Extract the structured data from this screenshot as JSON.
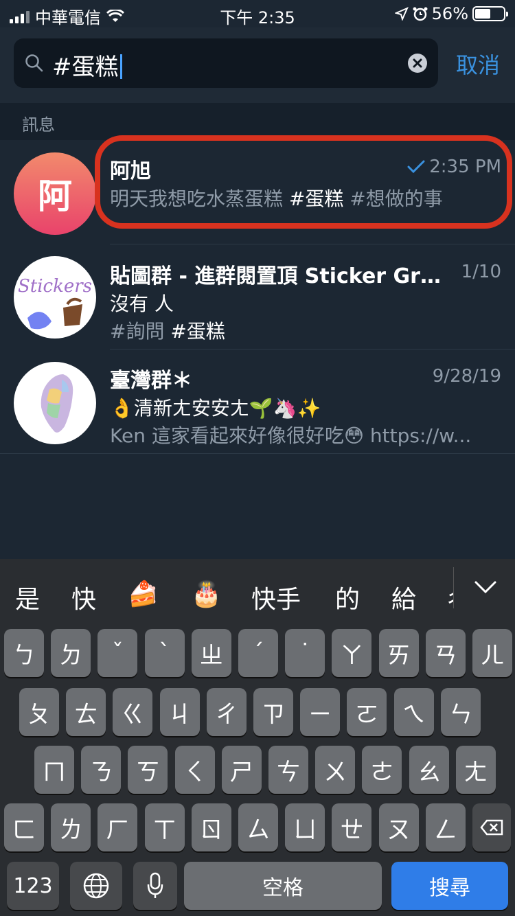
{
  "status_bar": {
    "carrier": "中華電信",
    "time": "下午 2:35",
    "battery": "56%",
    "battery_level": 0.56
  },
  "search": {
    "query": "#蛋糕",
    "cancel_label": "取消"
  },
  "section_header": "訊息",
  "results": [
    {
      "avatar_letter": "阿",
      "title": "阿旭",
      "time": "2:35 PM",
      "read": true,
      "preview_text": "明天我想吃水蒸蛋糕 ",
      "preview_tag1": "#蛋糕",
      "preview_tag2": " #想做的事"
    },
    {
      "avatar_text": "Stickers",
      "title": "貼圖群 - 進群閱置頂 Sticker Gro...",
      "time": "1/10",
      "line1": "沒有 人",
      "line2_tag1": "#詢問",
      "line2_tag2": " #蛋糕"
    },
    {
      "title": "臺灣群＊",
      "time": "9/28/19",
      "line1": "👌清新ㄤ安安ㄤ🌱🦄✨",
      "line2": "Ken 這家看起來好像很好吃😳 https://w..."
    }
  ],
  "suggestions": [
    "是",
    "快",
    "🍰",
    "🎂",
    "快手",
    "的",
    "給",
    "ㄔ"
  ],
  "keyboard": {
    "row1": [
      "ㄅ",
      "ㄉ",
      "ˇ",
      "ˋ",
      "ㄓ",
      "ˊ",
      "˙",
      "ㄚ",
      "ㄞ",
      "ㄢ",
      "ㄦ"
    ],
    "row2": [
      "ㄆ",
      "ㄊ",
      "ㄍ",
      "ㄐ",
      "ㄔ",
      "ㄗ",
      "ㄧ",
      "ㄛ",
      "ㄟ",
      "ㄣ"
    ],
    "row3": [
      "ㄇ",
      "ㄋ",
      "ㄎ",
      "ㄑ",
      "ㄕ",
      "ㄘ",
      "ㄨ",
      "ㄜ",
      "ㄠ",
      "ㄤ"
    ],
    "row4": [
      "ㄈ",
      "ㄌ",
      "ㄏ",
      "ㄒ",
      "ㄖ",
      "ㄙ",
      "ㄩ",
      "ㄝ",
      "ㄡ",
      "ㄥ"
    ],
    "numbers_label": "123",
    "space_label": "空格",
    "search_label": "搜尋"
  },
  "colors": {
    "accent": "#3a92e0",
    "highlight_ring": "#d8321f",
    "search_key": "#2f7de8"
  }
}
